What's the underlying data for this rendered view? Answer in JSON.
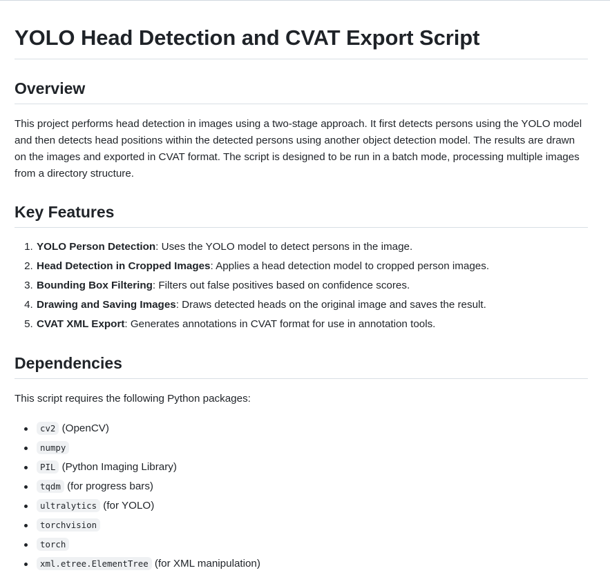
{
  "title": "YOLO Head Detection and CVAT Export Script",
  "overview": {
    "heading": "Overview",
    "text": "This project performs head detection in images using a two-stage approach. It first detects persons using the YOLO model and then detects head positions within the detected persons using another object detection model. The results are drawn on the images and exported in CVAT format. The script is designed to be run in a batch mode, processing multiple images from a directory structure."
  },
  "features": {
    "heading": "Key Features",
    "items": [
      {
        "name": "YOLO Person Detection",
        "desc": ": Uses the YOLO model to detect persons in the image."
      },
      {
        "name": "Head Detection in Cropped Images",
        "desc": ": Applies a head detection model to cropped person images."
      },
      {
        "name": "Bounding Box Filtering",
        "desc": ": Filters out false positives based on confidence scores."
      },
      {
        "name": "Drawing and Saving Images",
        "desc": ": Draws detected heads on the original image and saves the result."
      },
      {
        "name": "CVAT XML Export",
        "desc": ": Generates annotations in CVAT format for use in annotation tools."
      }
    ]
  },
  "dependencies": {
    "heading": "Dependencies",
    "intro": "This script requires the following Python packages:",
    "items": [
      {
        "code": "cv2",
        "note": " (OpenCV)"
      },
      {
        "code": "numpy",
        "note": ""
      },
      {
        "code": "PIL",
        "note": " (Python Imaging Library)"
      },
      {
        "code": "tqdm",
        "note": " (for progress bars)"
      },
      {
        "code": "ultralytics",
        "note": " (for YOLO)"
      },
      {
        "code": "torchvision",
        "note": ""
      },
      {
        "code": "torch",
        "note": ""
      },
      {
        "code": "xml.etree.ElementTree",
        "note": " (for XML manipulation)"
      }
    ]
  }
}
